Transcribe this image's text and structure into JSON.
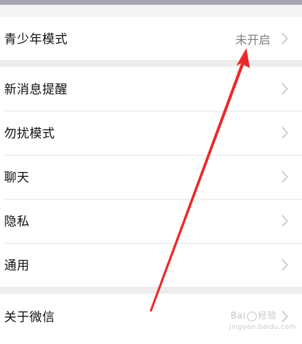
{
  "settings": {
    "youth_mode": {
      "label": "青少年模式",
      "value": "未开启"
    },
    "items": [
      {
        "label": "新消息提醒"
      },
      {
        "label": "勿扰模式"
      },
      {
        "label": "聊天"
      },
      {
        "label": "隐私"
      },
      {
        "label": "通用"
      }
    ],
    "about": {
      "label": "关于微信"
    }
  },
  "annotation": {
    "arrow_color": "#ea2a2a"
  },
  "watermark": {
    "text_left": "Bai",
    "text_right": "经验",
    "sub": "jingyan.baidu.com"
  },
  "colors": {
    "background": "#ededed",
    "row_background": "#ffffff",
    "label": "#111111",
    "value": "#7f7f7f",
    "chevron": "#c7c7cc",
    "top_bar": "#a8a4b0"
  }
}
